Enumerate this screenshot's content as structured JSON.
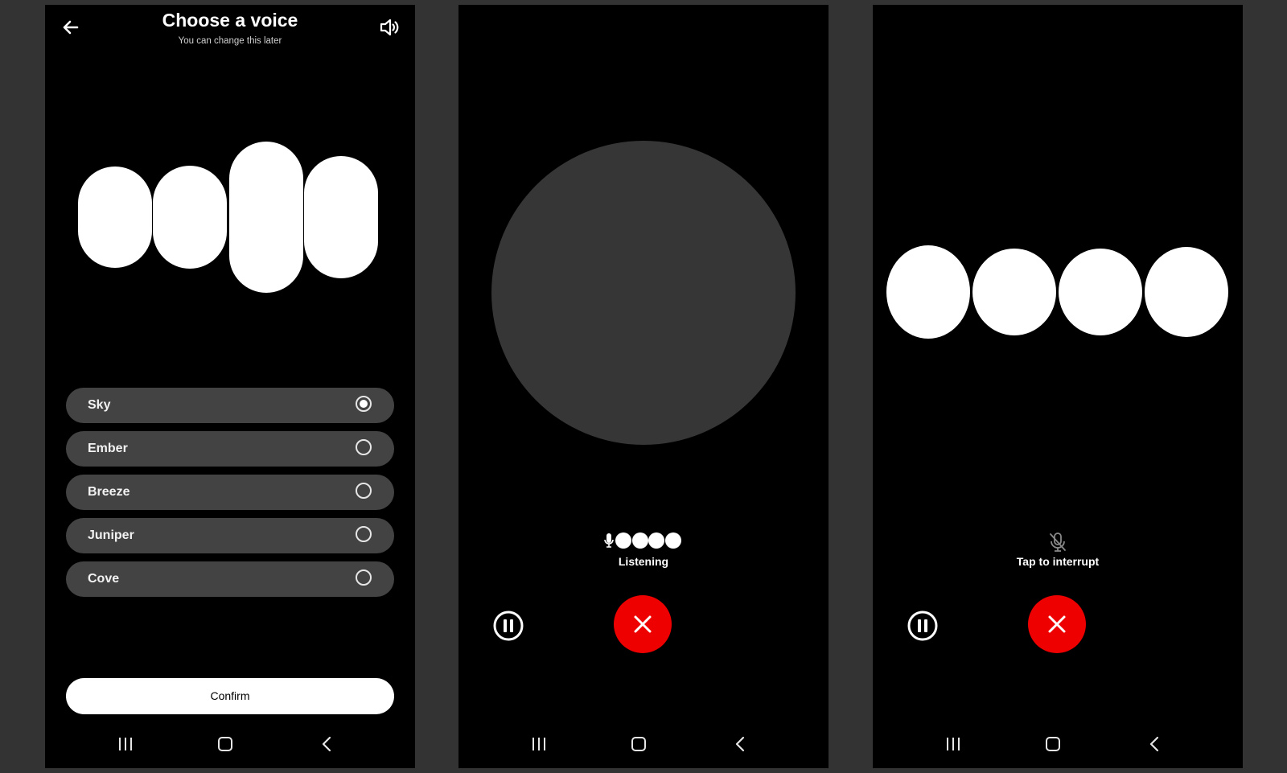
{
  "voice_picker": {
    "title": "Choose a voice",
    "subtitle": "You can change this later",
    "back_icon": "arrow-left-icon",
    "speaker_icon": "speaker-icon",
    "voices": [
      {
        "label": "Sky",
        "selected": true
      },
      {
        "label": "Ember",
        "selected": false
      },
      {
        "label": "Breeze",
        "selected": false
      },
      {
        "label": "Juniper",
        "selected": false
      },
      {
        "label": "Cove",
        "selected": false
      }
    ],
    "confirm_label": "Confirm"
  },
  "listening_screen": {
    "status_label": "Listening",
    "pause_icon": "pause-icon",
    "end_icon": "close-icon"
  },
  "speaking_screen": {
    "status_label": "Tap to interrupt",
    "mic_icon": "mic-muted-icon",
    "pause_icon": "pause-icon",
    "end_icon": "close-icon"
  },
  "navbar": {
    "icons": [
      "recent-apps-icon",
      "home-icon",
      "back-icon"
    ]
  },
  "colors": {
    "background": "#333333",
    "screen": "#000000",
    "list_item": "#434343",
    "circle": "#363636",
    "end_call": "#ee0000",
    "foreground": "#ffffff"
  }
}
